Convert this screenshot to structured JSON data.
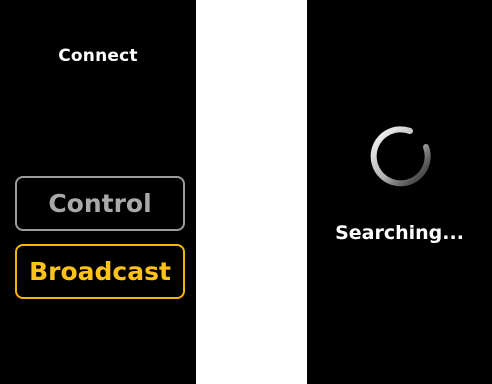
{
  "connect_screen": {
    "title": "Connect",
    "options": [
      {
        "label": "Control",
        "state": "unselected",
        "color": "#a9a9a9"
      },
      {
        "label": "Broadcast",
        "state": "selected",
        "color": "#ffc21a"
      }
    ]
  },
  "searching_screen": {
    "status": "Searching...",
    "spinner_icon": "loading-spinner-icon"
  },
  "colors": {
    "background": "#000000",
    "accent": "#ffc21a",
    "inactive": "#9a9a9a",
    "text": "#ffffff"
  }
}
